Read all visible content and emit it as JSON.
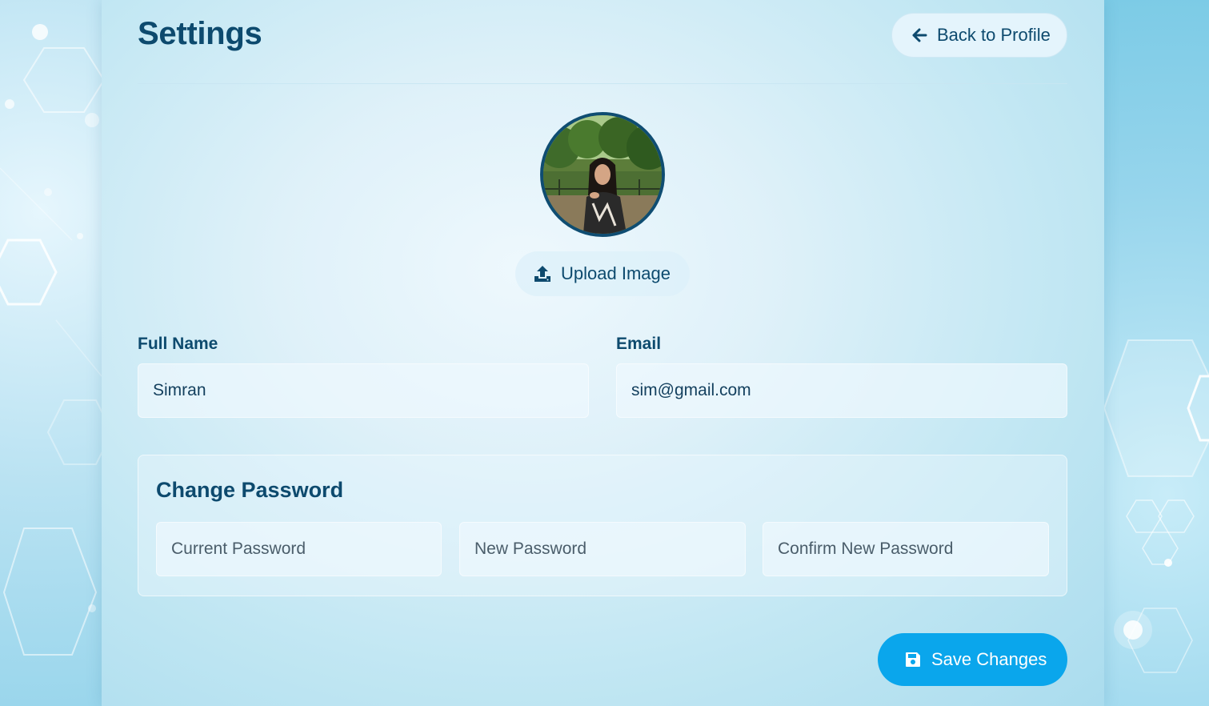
{
  "header": {
    "title": "Settings",
    "back_button_label": "Back to Profile",
    "back_icon": "arrow-left-icon"
  },
  "profile": {
    "avatar_icon": "user-photo",
    "upload_button_label": "Upload Image",
    "upload_icon": "upload-icon"
  },
  "form": {
    "full_name_label": "Full Name",
    "full_name_value": "Simran",
    "email_label": "Email",
    "email_value": "sim@gmail.com"
  },
  "password": {
    "title": "Change Password",
    "current_placeholder": "Current Password",
    "new_placeholder": "New Password",
    "confirm_placeholder": "Confirm New Password"
  },
  "actions": {
    "save_label": "Save Changes",
    "save_icon": "floppy-disk-icon"
  },
  "colors": {
    "primary_text": "#0d4a6e",
    "accent": "#0aa6ec"
  }
}
